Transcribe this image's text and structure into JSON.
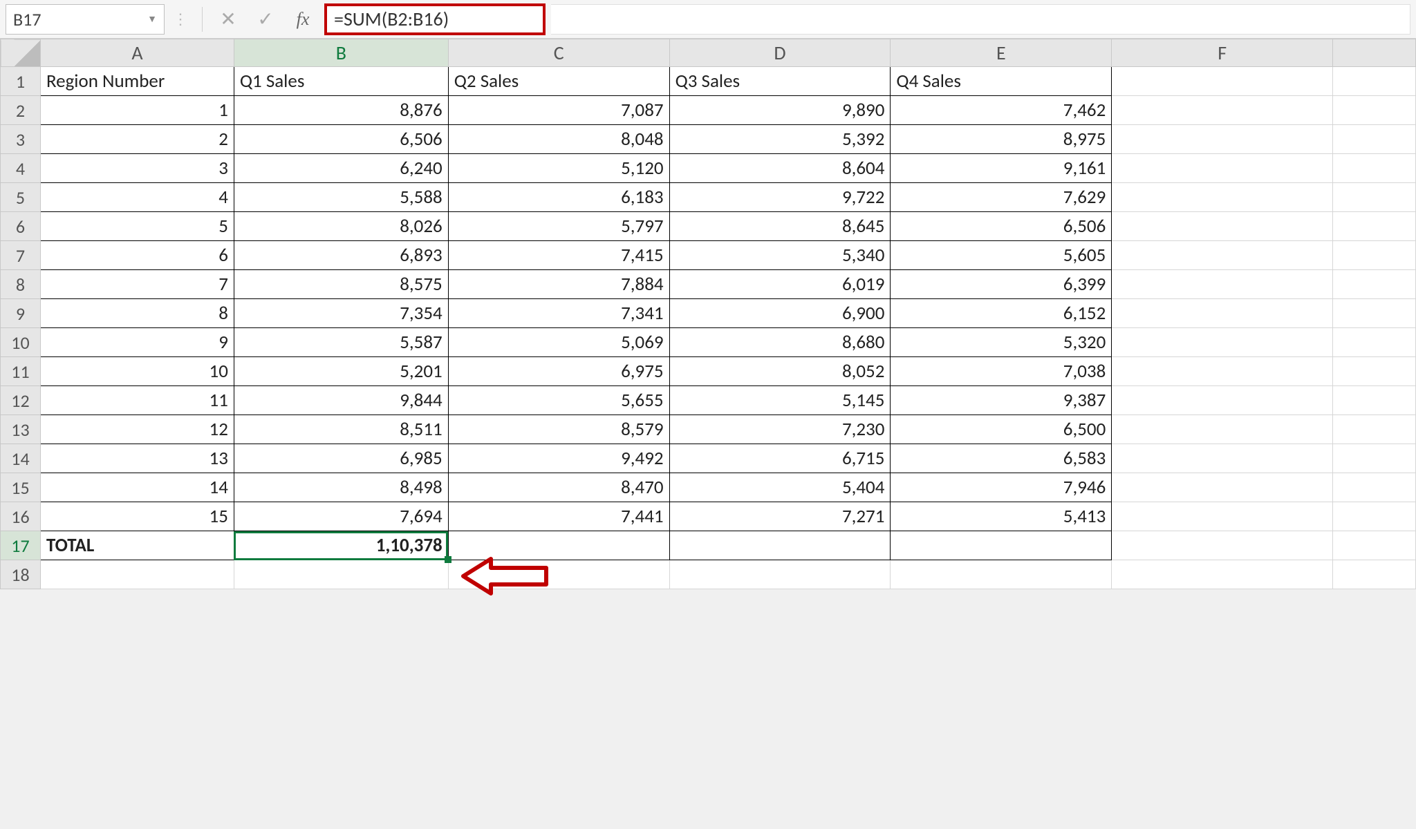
{
  "formula_bar": {
    "name_box": "B17",
    "fx_label": "fx",
    "formula": "=SUM(B2:B16)"
  },
  "columns": [
    "A",
    "B",
    "C",
    "D",
    "E",
    "F"
  ],
  "row_numbers": [
    1,
    2,
    3,
    4,
    5,
    6,
    7,
    8,
    9,
    10,
    11,
    12,
    13,
    14,
    15,
    16,
    17,
    18
  ],
  "headers": {
    "A": "Region Number",
    "B": "Q1 Sales",
    "C": "Q2 Sales",
    "D": "Q3 Sales",
    "E": "Q4 Sales"
  },
  "rows": [
    {
      "A": "1",
      "B": "8,876",
      "C": "7,087",
      "D": "9,890",
      "E": "7,462"
    },
    {
      "A": "2",
      "B": "6,506",
      "C": "8,048",
      "D": "5,392",
      "E": "8,975"
    },
    {
      "A": "3",
      "B": "6,240",
      "C": "5,120",
      "D": "8,604",
      "E": "9,161"
    },
    {
      "A": "4",
      "B": "5,588",
      "C": "6,183",
      "D": "9,722",
      "E": "7,629"
    },
    {
      "A": "5",
      "B": "8,026",
      "C": "5,797",
      "D": "8,645",
      "E": "6,506"
    },
    {
      "A": "6",
      "B": "6,893",
      "C": "7,415",
      "D": "5,340",
      "E": "5,605"
    },
    {
      "A": "7",
      "B": "8,575",
      "C": "7,884",
      "D": "6,019",
      "E": "6,399"
    },
    {
      "A": "8",
      "B": "7,354",
      "C": "7,341",
      "D": "6,900",
      "E": "6,152"
    },
    {
      "A": "9",
      "B": "5,587",
      "C": "5,069",
      "D": "8,680",
      "E": "5,320"
    },
    {
      "A": "10",
      "B": "5,201",
      "C": "6,975",
      "D": "8,052",
      "E": "7,038"
    },
    {
      "A": "11",
      "B": "9,844",
      "C": "5,655",
      "D": "5,145",
      "E": "9,387"
    },
    {
      "A": "12",
      "B": "8,511",
      "C": "8,579",
      "D": "7,230",
      "E": "6,500"
    },
    {
      "A": "13",
      "B": "6,985",
      "C": "9,492",
      "D": "6,715",
      "E": "6,583"
    },
    {
      "A": "14",
      "B": "8,498",
      "C": "8,470",
      "D": "5,404",
      "E": "7,946"
    },
    {
      "A": "15",
      "B": "7,694",
      "C": "7,441",
      "D": "7,271",
      "E": "5,413"
    }
  ],
  "total_row": {
    "label": "TOTAL",
    "B": "1,10,378"
  },
  "selected_cell": "B17",
  "annotation": {
    "formula_box_color": "#c00000",
    "arrow_color": "#c00000"
  }
}
